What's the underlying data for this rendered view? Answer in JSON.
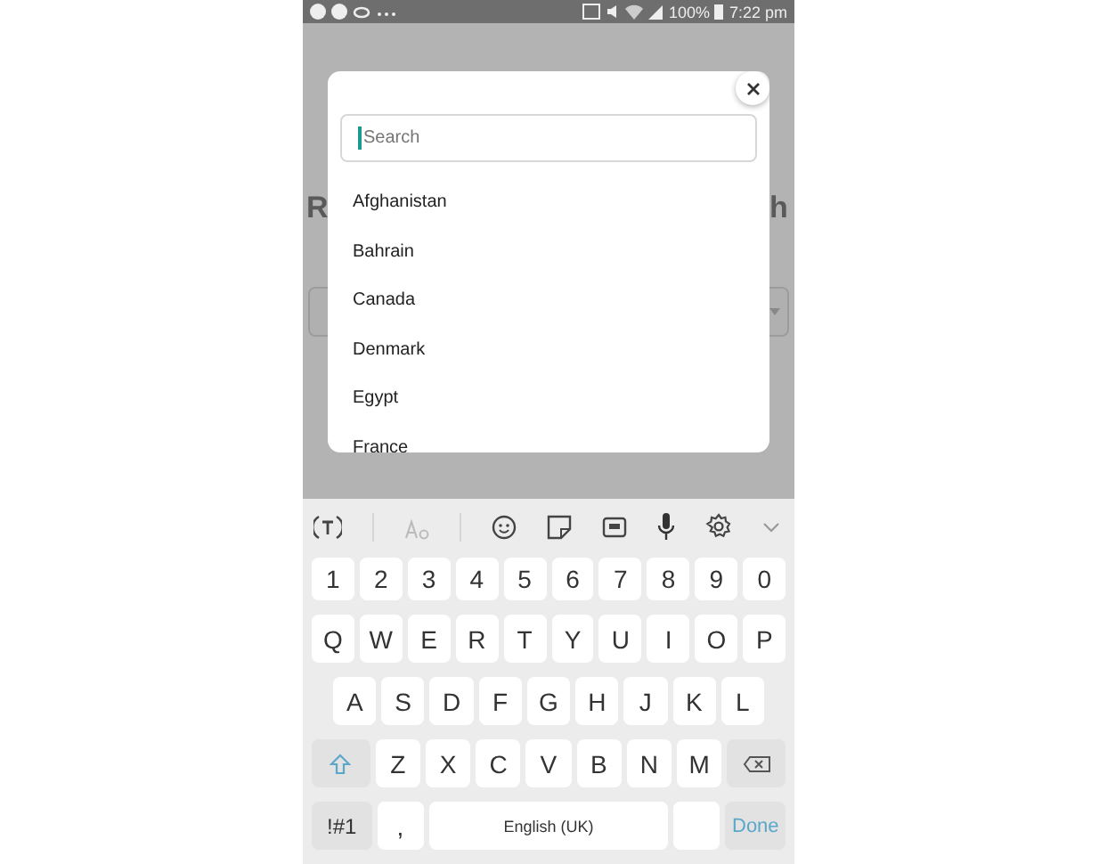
{
  "status_bar": {
    "battery": "100%",
    "time": "7:22 pm"
  },
  "background": {
    "heading_left": "R",
    "heading_right": "h"
  },
  "dialog": {
    "search": {
      "placeholder": "Search",
      "focused": true
    },
    "items": [
      {
        "label": "Afghanistan"
      },
      {
        "label": "Bahrain"
      },
      {
        "label": "Canada"
      },
      {
        "label": "Denmark"
      },
      {
        "label": "Egypt"
      },
      {
        "label": "France"
      }
    ]
  },
  "keyboard": {
    "language": "English (UK)",
    "rows": [
      {
        "keys": [
          {
            "kind": "char",
            "label": "1"
          },
          {
            "kind": "char",
            "label": "2"
          },
          {
            "kind": "char",
            "label": "3"
          },
          {
            "kind": "char",
            "label": "4"
          },
          {
            "kind": "char",
            "label": "5"
          },
          {
            "kind": "char",
            "label": "6"
          },
          {
            "kind": "char",
            "label": "7"
          },
          {
            "kind": "char",
            "label": "8"
          },
          {
            "kind": "char",
            "label": "9"
          },
          {
            "kind": "char",
            "label": "0"
          }
        ]
      },
      {
        "keys": [
          {
            "kind": "char",
            "label": "Q"
          },
          {
            "kind": "char",
            "label": "W"
          },
          {
            "kind": "char",
            "label": "E"
          },
          {
            "kind": "char",
            "label": "R"
          },
          {
            "kind": "char",
            "label": "T"
          },
          {
            "kind": "char",
            "label": "Y"
          },
          {
            "kind": "char",
            "label": "U"
          },
          {
            "kind": "char",
            "label": "I"
          },
          {
            "kind": "char",
            "label": "O"
          },
          {
            "kind": "char",
            "label": "P"
          }
        ]
      },
      {
        "keys": [
          {
            "kind": "char",
            "label": "A"
          },
          {
            "kind": "char",
            "label": "S"
          },
          {
            "kind": "char",
            "label": "D"
          },
          {
            "kind": "char",
            "label": "F"
          },
          {
            "kind": "char",
            "label": "G"
          },
          {
            "kind": "char",
            "label": "H"
          },
          {
            "kind": "char",
            "label": "J"
          },
          {
            "kind": "char",
            "label": "K"
          },
          {
            "kind": "char",
            "label": "L"
          }
        ]
      },
      {
        "keys": [
          {
            "kind": "shift"
          },
          {
            "kind": "char",
            "label": "Z"
          },
          {
            "kind": "char",
            "label": "X"
          },
          {
            "kind": "char",
            "label": "C"
          },
          {
            "kind": "char",
            "label": "V"
          },
          {
            "kind": "char",
            "label": "B"
          },
          {
            "kind": "char",
            "label": "N"
          },
          {
            "kind": "char",
            "label": "M"
          },
          {
            "kind": "backspace"
          }
        ]
      },
      {
        "keys": [
          {
            "kind": "symbol",
            "label": "!#1"
          },
          {
            "kind": "char",
            "label": ","
          },
          {
            "kind": "space"
          },
          {
            "kind": "blank"
          },
          {
            "kind": "done",
            "label": "Done"
          }
        ]
      }
    ]
  }
}
